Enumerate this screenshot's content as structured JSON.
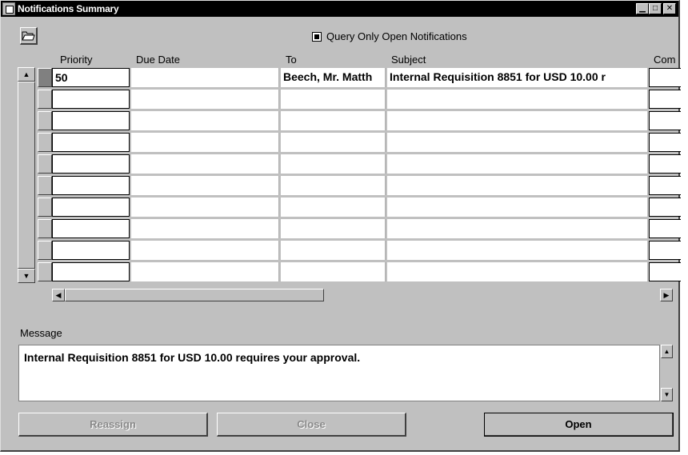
{
  "window": {
    "title": "Notifications Summary",
    "controls": {
      "minimize": "▁",
      "maximize": "□",
      "close": "✕"
    }
  },
  "toolbar": {
    "open_folder_icon": "folder-open-icon",
    "query_only_open_label": "Query Only Open Notifications",
    "query_only_open_checked": true
  },
  "table": {
    "headers": {
      "priority": "Priority",
      "due_date": "Due Date",
      "to": "To",
      "subject": "Subject",
      "comments": "Com"
    },
    "rows": [
      {
        "priority": "50",
        "due_date": "",
        "to": "Beech, Mr. Matth",
        "subject": "Internal Requisition 8851 for  USD 10.00 r",
        "comments": ""
      },
      {
        "priority": "",
        "due_date": "",
        "to": "",
        "subject": "",
        "comments": ""
      },
      {
        "priority": "",
        "due_date": "",
        "to": "",
        "subject": "",
        "comments": ""
      },
      {
        "priority": "",
        "due_date": "",
        "to": "",
        "subject": "",
        "comments": ""
      },
      {
        "priority": "",
        "due_date": "",
        "to": "",
        "subject": "",
        "comments": ""
      },
      {
        "priority": "",
        "due_date": "",
        "to": "",
        "subject": "",
        "comments": ""
      },
      {
        "priority": "",
        "due_date": "",
        "to": "",
        "subject": "",
        "comments": ""
      },
      {
        "priority": "",
        "due_date": "",
        "to": "",
        "subject": "",
        "comments": ""
      },
      {
        "priority": "",
        "due_date": "",
        "to": "",
        "subject": "",
        "comments": ""
      },
      {
        "priority": "",
        "due_date": "",
        "to": "",
        "subject": "",
        "comments": ""
      }
    ],
    "selected_row": 0
  },
  "scroll": {
    "up_arrow": "▲",
    "down_arrow": "▼",
    "left_arrow": "◀",
    "right_arrow": "▶"
  },
  "message": {
    "label": "Message",
    "text": "Internal Requisition  8851 for USD 10.00 requires your approval."
  },
  "buttons": {
    "reassign": "Reassign",
    "close": "Close",
    "open": "Open"
  }
}
